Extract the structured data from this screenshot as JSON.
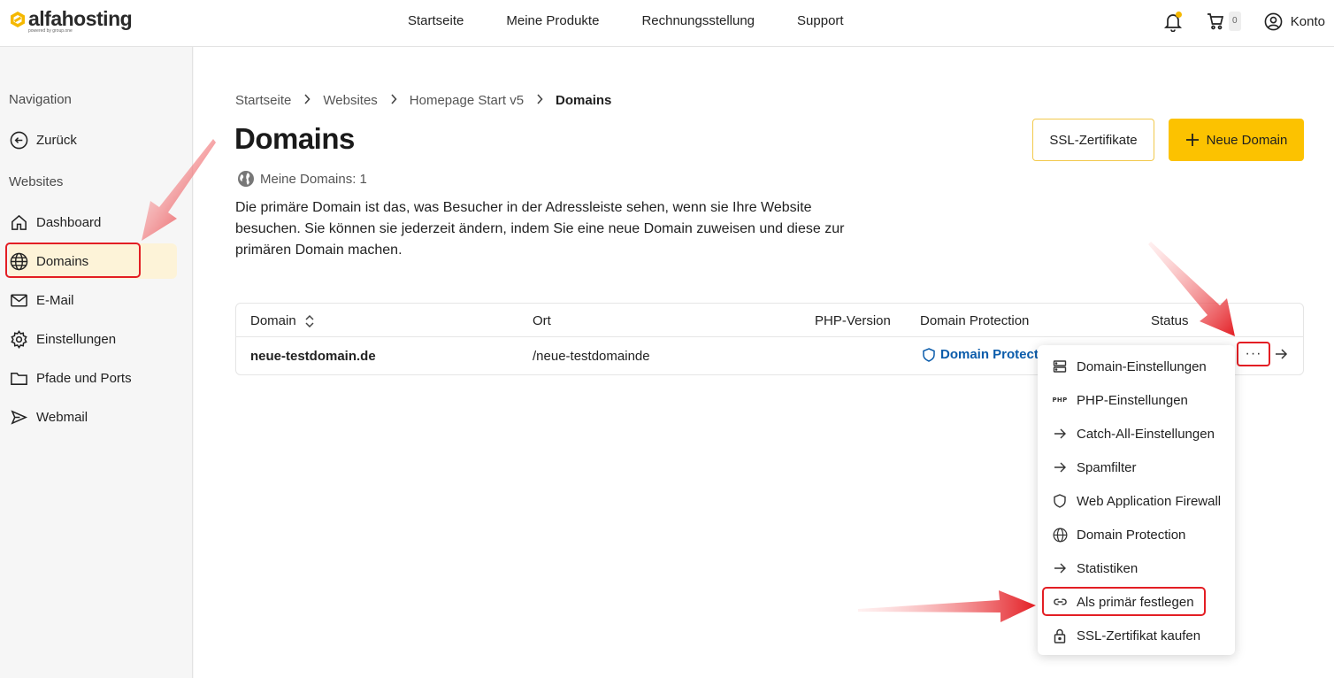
{
  "brand": {
    "name": "alfahosting",
    "tagline": "powered by group.one"
  },
  "topnav": {
    "items": [
      "Startseite",
      "Meine Produkte",
      "Rechnungsstellung",
      "Support"
    ],
    "cart_count": "0",
    "account_label": "Konto"
  },
  "sidebar": {
    "heading_nav": "Navigation",
    "back_label": "Zurück",
    "heading_websites": "Websites",
    "items": [
      {
        "label": "Dashboard",
        "icon": "home-icon"
      },
      {
        "label": "Domains",
        "icon": "globe-icon",
        "active": true
      },
      {
        "label": "E-Mail",
        "icon": "mail-icon"
      },
      {
        "label": "Einstellungen",
        "icon": "gear-icon"
      },
      {
        "label": "Pfade und Ports",
        "icon": "folder-icon"
      },
      {
        "label": "Webmail",
        "icon": "send-icon"
      }
    ]
  },
  "breadcrumb": [
    "Startseite",
    "Websites",
    "Homepage Start v5",
    "Domains"
  ],
  "page": {
    "title": "Domains",
    "count_label": "Meine Domains: 1",
    "description": "Die primäre Domain ist das, was Besucher in der Adressleiste sehen, wenn sie Ihre Website besuchen. Sie können sie jederzeit ändern, indem Sie eine neue Domain zuweisen und diese zur primären Domain machen.",
    "btn_ssl": "SSL-Zertifikate",
    "btn_new": "Neue Domain"
  },
  "table": {
    "columns": [
      "Domain",
      "Ort",
      "PHP-Version",
      "Domain Protection",
      "Status"
    ],
    "rows": [
      {
        "domain": "neue-testdomain.de",
        "ort": "/neue-testdomainde",
        "php": "",
        "protection": "Domain Protection",
        "status": ""
      }
    ],
    "menu_dots": "···"
  },
  "dropdown": {
    "items": [
      {
        "label": "Domain-Einstellungen",
        "icon": "server-icon"
      },
      {
        "label": "PHP-Einstellungen",
        "icon": "php-icon",
        "icon_text": "PHP"
      },
      {
        "label": "Catch-All-Einstellungen",
        "icon": "arrow-right-icon"
      },
      {
        "label": "Spamfilter",
        "icon": "arrow-right-icon"
      },
      {
        "label": "Web Application Firewall",
        "icon": "shield-icon"
      },
      {
        "label": "Domain Protection",
        "icon": "globe-icon"
      },
      {
        "label": "Statistiken",
        "icon": "arrow-right-icon"
      },
      {
        "label": "Als primär festlegen",
        "icon": "link-icon",
        "highlighted": true
      },
      {
        "label": "SSL-Zertifikat kaufen",
        "icon": "lock-icon"
      }
    ]
  },
  "colors": {
    "accent": "#fcc200",
    "highlight_red": "#e31e24",
    "link_blue": "#0b5cab",
    "active_bg": "#fdf3d8"
  }
}
